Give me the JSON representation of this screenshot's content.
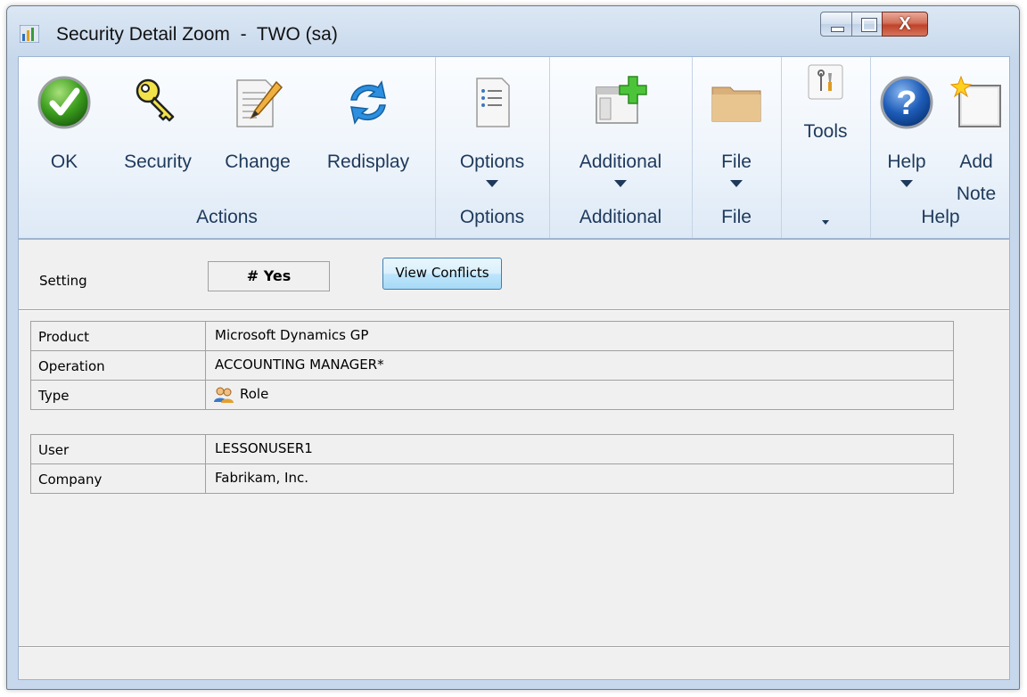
{
  "window": {
    "title": "Security Detail Zoom  -  TWO (sa)",
    "icon": "app-chart-icon",
    "controls": {
      "minimize": "minimize-icon",
      "maximize": "maximize-icon",
      "close": "X"
    }
  },
  "ribbon": {
    "groups": [
      {
        "label": "Actions",
        "buttons": [
          {
            "label": "OK",
            "icon": "ok-check-icon"
          },
          {
            "label": "Security",
            "icon": "key-icon"
          },
          {
            "label": "Change",
            "icon": "edit-document-icon"
          },
          {
            "label": "Redisplay",
            "icon": "refresh-icon"
          }
        ]
      },
      {
        "label": "Options",
        "buttons": [
          {
            "label": "Options",
            "icon": "options-list-icon",
            "dropdown": true
          }
        ]
      },
      {
        "label": "Additional",
        "buttons": [
          {
            "label": "Additional",
            "icon": "additional-window-icon",
            "dropdown": true
          }
        ]
      },
      {
        "label": "File",
        "buttons": [
          {
            "label": "File",
            "icon": "folder-icon",
            "dropdown": true
          }
        ]
      },
      {
        "label": "",
        "buttons": [
          {
            "label": "Tools",
            "icon": "tools-icon"
          }
        ],
        "expander": "expand-icon"
      },
      {
        "label": "Help",
        "buttons": [
          {
            "label": "Help",
            "icon": "help-icon",
            "dropdown": true
          },
          {
            "label": "Add Note",
            "icon": "note-icon",
            "line1": "Add",
            "line2": "Note"
          }
        ]
      }
    ]
  },
  "form": {
    "setting_label": "Setting",
    "setting_value": "# Yes",
    "view_conflicts": "View Conflicts",
    "product_label": "Product",
    "product_value": "Microsoft Dynamics GP",
    "operation_label": "Operation",
    "operation_value": "ACCOUNTING MANAGER*",
    "type_label": "Type",
    "type_value": "Role",
    "type_icon": "role-users-icon",
    "user_label": "User",
    "user_value": "LESSONUSER1",
    "company_label": "Company",
    "company_value": "Fabrikam, Inc."
  },
  "colors": {
    "ribbon_text": "#1e395b",
    "frame": "#c7d8ec",
    "content_bg": "#f0f0f0"
  }
}
